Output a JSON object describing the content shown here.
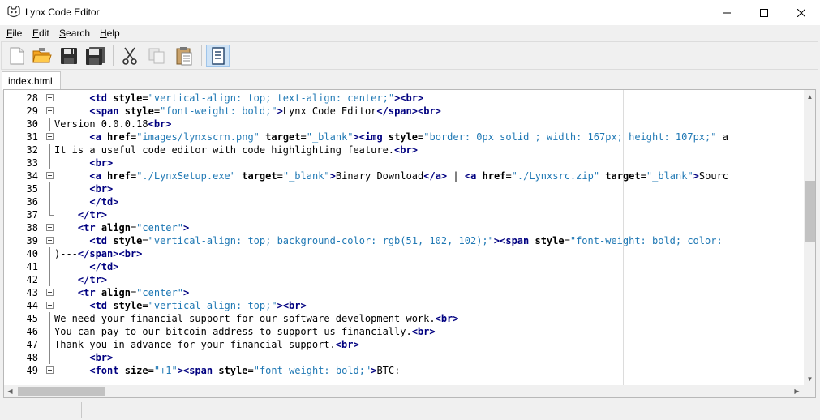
{
  "window": {
    "title": "Lynx Code Editor",
    "minimize_glyph": "—",
    "maximize_glyph": "☐",
    "close_glyph": "✕"
  },
  "menu": [
    {
      "label": "File",
      "underline": "F",
      "rest": "ile"
    },
    {
      "label": "Edit",
      "underline": "E",
      "rest": "dit"
    },
    {
      "label": "Search",
      "underline": "S",
      "rest": "earch"
    },
    {
      "label": "Help",
      "underline": "H",
      "rest": "elp"
    }
  ],
  "toolbar": {
    "icons": [
      "new-file-icon",
      "open-folder-icon",
      "save-icon",
      "save-all-icon",
      "cut-icon",
      "copy-icon",
      "paste-icon",
      "document-properties-icon"
    ]
  },
  "tabs": [
    {
      "label": "index.html",
      "active": true
    }
  ],
  "editor": {
    "lines": [
      {
        "n": "28",
        "fold": "box",
        "tokens": [
          [
            "tx",
            "      "
          ],
          [
            "tg",
            "<td "
          ],
          [
            "at",
            "style"
          ],
          [
            "tx",
            "="
          ],
          [
            "st",
            "\"vertical-align: top; text-align: center;\""
          ],
          [
            "tg",
            ">"
          ],
          [
            "tg",
            "<br>"
          ]
        ]
      },
      {
        "n": "29",
        "fold": "box",
        "tokens": [
          [
            "tx",
            "      "
          ],
          [
            "tg",
            "<span "
          ],
          [
            "at",
            "style"
          ],
          [
            "tx",
            "="
          ],
          [
            "st",
            "\"font-weight: bold;\""
          ],
          [
            "tg",
            ">"
          ],
          [
            "tx",
            "Lynx Code Editor"
          ],
          [
            "tg",
            "</span>"
          ],
          [
            "tg",
            "<br>"
          ]
        ]
      },
      {
        "n": "30",
        "fold": "",
        "tokens": [
          [
            "tx",
            "Version 0.0.0.18"
          ],
          [
            "tg",
            "<br>"
          ]
        ]
      },
      {
        "n": "31",
        "fold": "box",
        "tokens": [
          [
            "tx",
            "      "
          ],
          [
            "tg",
            "<a "
          ],
          [
            "at",
            "href"
          ],
          [
            "tx",
            "="
          ],
          [
            "st",
            "\"images/lynxscrn.png\""
          ],
          [
            "tx",
            " "
          ],
          [
            "at",
            "target"
          ],
          [
            "tx",
            "="
          ],
          [
            "st",
            "\"_blank\""
          ],
          [
            "tg",
            ">"
          ],
          [
            "tg",
            "<img "
          ],
          [
            "at",
            "style"
          ],
          [
            "tx",
            "="
          ],
          [
            "st",
            "\"border: 0px solid ; width: 167px; height: 107px;\""
          ],
          [
            "tx",
            " a"
          ]
        ]
      },
      {
        "n": "32",
        "fold": "",
        "tokens": [
          [
            "tx",
            "It is a useful code editor with code highlighting feature."
          ],
          [
            "tg",
            "<br>"
          ]
        ]
      },
      {
        "n": "33",
        "fold": "",
        "tokens": [
          [
            "tx",
            "      "
          ],
          [
            "tg",
            "<br>"
          ]
        ]
      },
      {
        "n": "34",
        "fold": "box",
        "tokens": [
          [
            "tx",
            "      "
          ],
          [
            "tg",
            "<a "
          ],
          [
            "at",
            "href"
          ],
          [
            "tx",
            "="
          ],
          [
            "st",
            "\"./LynxSetup.exe\""
          ],
          [
            "tx",
            " "
          ],
          [
            "at",
            "target"
          ],
          [
            "tx",
            "="
          ],
          [
            "st",
            "\"_blank\""
          ],
          [
            "tg",
            ">"
          ],
          [
            "tx",
            "Binary Download"
          ],
          [
            "tg",
            "</a>"
          ],
          [
            "tx",
            " | "
          ],
          [
            "tg",
            "<a "
          ],
          [
            "at",
            "href"
          ],
          [
            "tx",
            "="
          ],
          [
            "st",
            "\"./Lynxsrc.zip\""
          ],
          [
            "tx",
            " "
          ],
          [
            "at",
            "target"
          ],
          [
            "tx",
            "="
          ],
          [
            "st",
            "\"_blank\""
          ],
          [
            "tg",
            ">"
          ],
          [
            "tx",
            "Sourc"
          ]
        ]
      },
      {
        "n": "35",
        "fold": "",
        "tokens": [
          [
            "tx",
            "      "
          ],
          [
            "tg",
            "<br>"
          ]
        ]
      },
      {
        "n": "36",
        "fold": "",
        "tokens": [
          [
            "tx",
            "      "
          ],
          [
            "tg",
            "</td>"
          ]
        ]
      },
      {
        "n": "37",
        "fold": "end",
        "tokens": [
          [
            "tx",
            "    "
          ],
          [
            "tg",
            "</tr>"
          ]
        ]
      },
      {
        "n": "38",
        "fold": "box",
        "tokens": [
          [
            "tx",
            "    "
          ],
          [
            "tg",
            "<tr "
          ],
          [
            "at",
            "align"
          ],
          [
            "tx",
            "="
          ],
          [
            "st",
            "\"center\""
          ],
          [
            "tg",
            ">"
          ]
        ]
      },
      {
        "n": "39",
        "fold": "box",
        "tokens": [
          [
            "tx",
            "      "
          ],
          [
            "tg",
            "<td "
          ],
          [
            "at",
            "style"
          ],
          [
            "tx",
            "="
          ],
          [
            "st",
            "\"vertical-align: top; background-color: rgb(51, 102, 102);\""
          ],
          [
            "tg",
            ">"
          ],
          [
            "tg",
            "<span "
          ],
          [
            "at",
            "style"
          ],
          [
            "tx",
            "="
          ],
          [
            "st",
            "\"font-weight: bold; color:"
          ]
        ]
      },
      {
        "n": "40",
        "fold": "",
        "tokens": [
          [
            "tx",
            ")---"
          ],
          [
            "tg",
            "</span>"
          ],
          [
            "tg",
            "<br>"
          ]
        ]
      },
      {
        "n": "41",
        "fold": "",
        "tokens": [
          [
            "tx",
            "      "
          ],
          [
            "tg",
            "</td>"
          ]
        ]
      },
      {
        "n": "42",
        "fold": "",
        "tokens": [
          [
            "tx",
            "    "
          ],
          [
            "tg",
            "</tr>"
          ]
        ]
      },
      {
        "n": "43",
        "fold": "box",
        "tokens": [
          [
            "tx",
            "    "
          ],
          [
            "tg",
            "<tr "
          ],
          [
            "at",
            "align"
          ],
          [
            "tx",
            "="
          ],
          [
            "st",
            "\"center\""
          ],
          [
            "tg",
            ">"
          ]
        ]
      },
      {
        "n": "44",
        "fold": "box",
        "tokens": [
          [
            "tx",
            "      "
          ],
          [
            "tg",
            "<td "
          ],
          [
            "at",
            "style"
          ],
          [
            "tx",
            "="
          ],
          [
            "st",
            "\"vertical-align: top;\""
          ],
          [
            "tg",
            ">"
          ],
          [
            "tg",
            "<br>"
          ]
        ]
      },
      {
        "n": "45",
        "fold": "",
        "tokens": [
          [
            "tx",
            "We need your financial support for our software development work."
          ],
          [
            "tg",
            "<br>"
          ]
        ]
      },
      {
        "n": "46",
        "fold": "",
        "tokens": [
          [
            "tx",
            "You can pay to our bitcoin address to support us financially."
          ],
          [
            "tg",
            "<br>"
          ]
        ]
      },
      {
        "n": "47",
        "fold": "",
        "tokens": [
          [
            "tx",
            "Thank you in advance for your financial support."
          ],
          [
            "tg",
            "<br>"
          ]
        ]
      },
      {
        "n": "48",
        "fold": "",
        "tokens": [
          [
            "tx",
            "      "
          ],
          [
            "tg",
            "<br>"
          ]
        ]
      },
      {
        "n": "49",
        "fold": "box",
        "tokens": [
          [
            "tx",
            "      "
          ],
          [
            "tg",
            "<font "
          ],
          [
            "at",
            "size"
          ],
          [
            "tx",
            "="
          ],
          [
            "st",
            "\"+1\""
          ],
          [
            "tg",
            ">"
          ],
          [
            "tg",
            "<span "
          ],
          [
            "at",
            "style"
          ],
          [
            "tx",
            "="
          ],
          [
            "st",
            "\"font-weight: bold;\""
          ],
          [
            "tg",
            ">"
          ],
          [
            "tx",
            "BTC:"
          ]
        ]
      }
    ]
  },
  "scrollbars": {
    "up_glyph": "▲",
    "down_glyph": "▼",
    "left_glyph": "◀",
    "right_glyph": "▶"
  }
}
